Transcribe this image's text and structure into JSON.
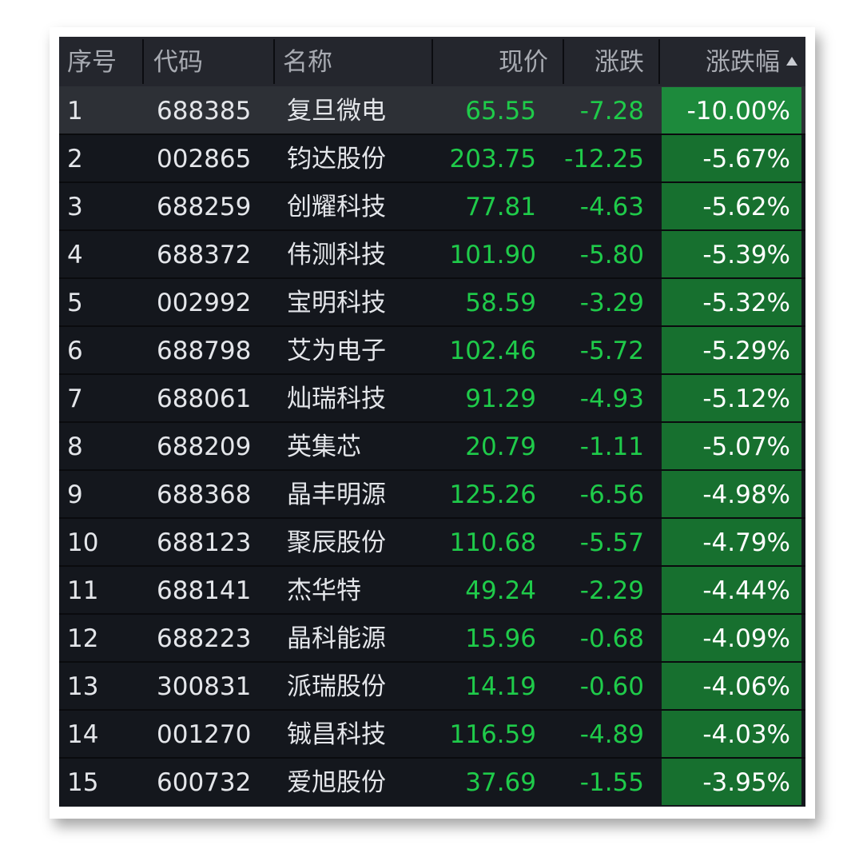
{
  "colors": {
    "background": "#14171d",
    "header_bg": "#24262d",
    "selected_row_bg": "#2d3036",
    "down_text": "#1fcb4a",
    "pct_cell_bg": "#17702f",
    "pct_cell_bg_selected": "#1d8a3c"
  },
  "table": {
    "headers": {
      "index": "序号",
      "code": "代码",
      "name": "名称",
      "price": "现价",
      "change": "涨跌",
      "pct_change": "涨跌幅"
    },
    "sort": {
      "column": "pct_change",
      "icon": "sort-ascending-triangle-icon"
    },
    "selected_row": 0,
    "rows": [
      {
        "index": "1",
        "code": "688385",
        "name": "复旦微电",
        "price": "65.55",
        "change": "-7.28",
        "pct": "-10.00%"
      },
      {
        "index": "2",
        "code": "002865",
        "name": "钧达股份",
        "price": "203.75",
        "change": "-12.25",
        "pct": "-5.67%"
      },
      {
        "index": "3",
        "code": "688259",
        "name": "创耀科技",
        "price": "77.81",
        "change": "-4.63",
        "pct": "-5.62%"
      },
      {
        "index": "4",
        "code": "688372",
        "name": "伟测科技",
        "price": "101.90",
        "change": "-5.80",
        "pct": "-5.39%"
      },
      {
        "index": "5",
        "code": "002992",
        "name": "宝明科技",
        "price": "58.59",
        "change": "-3.29",
        "pct": "-5.32%"
      },
      {
        "index": "6",
        "code": "688798",
        "name": "艾为电子",
        "price": "102.46",
        "change": "-5.72",
        "pct": "-5.29%"
      },
      {
        "index": "7",
        "code": "688061",
        "name": "灿瑞科技",
        "price": "91.29",
        "change": "-4.93",
        "pct": "-5.12%"
      },
      {
        "index": "8",
        "code": "688209",
        "name": "英集芯",
        "price": "20.79",
        "change": "-1.11",
        "pct": "-5.07%"
      },
      {
        "index": "9",
        "code": "688368",
        "name": "晶丰明源",
        "price": "125.26",
        "change": "-6.56",
        "pct": "-4.98%"
      },
      {
        "index": "10",
        "code": "688123",
        "name": "聚辰股份",
        "price": "110.68",
        "change": "-5.57",
        "pct": "-4.79%"
      },
      {
        "index": "11",
        "code": "688141",
        "name": "杰华特",
        "price": "49.24",
        "change": "-2.29",
        "pct": "-4.44%"
      },
      {
        "index": "12",
        "code": "688223",
        "name": "晶科能源",
        "price": "15.96",
        "change": "-0.68",
        "pct": "-4.09%"
      },
      {
        "index": "13",
        "code": "300831",
        "name": "派瑞股份",
        "price": "14.19",
        "change": "-0.60",
        "pct": "-4.06%"
      },
      {
        "index": "14",
        "code": "001270",
        "name": "铖昌科技",
        "price": "116.59",
        "change": "-4.89",
        "pct": "-4.03%"
      },
      {
        "index": "15",
        "code": "600732",
        "name": "爱旭股份",
        "price": "37.69",
        "change": "-1.55",
        "pct": "-3.95%"
      }
    ]
  }
}
